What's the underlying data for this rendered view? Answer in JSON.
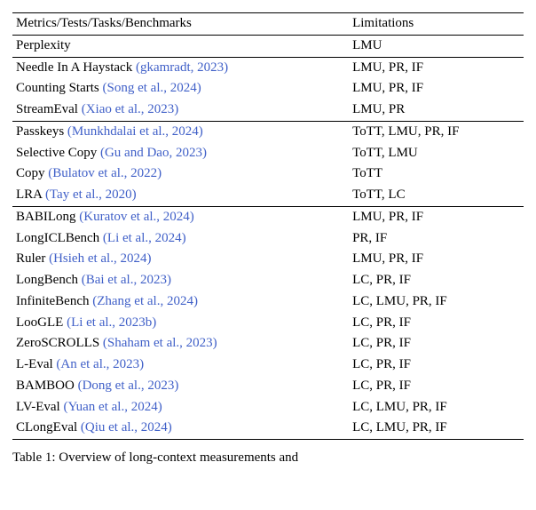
{
  "header": {
    "col1": "Metrics/Tests/Tasks/Benchmarks",
    "col2": "Limitations"
  },
  "groups": [
    {
      "rows": [
        {
          "name": "Perplexity",
          "ref": null,
          "lim": "LMU"
        }
      ]
    },
    {
      "rows": [
        {
          "name": "Needle In A Haystack ",
          "ref": "(gkamradt, 2023)",
          "lim": "LMU, PR, IF"
        },
        {
          "name": "Counting Starts ",
          "ref": "(Song et al., 2024)",
          "lim": "LMU, PR, IF"
        },
        {
          "name": "StreamEval ",
          "ref": "(Xiao et al., 2023)",
          "lim": "LMU, PR"
        }
      ]
    },
    {
      "rows": [
        {
          "name": "Passkeys ",
          "ref": "(Munkhdalai et al., 2024)",
          "lim": "ToTT, LMU, PR, IF"
        },
        {
          "name": "Selective Copy ",
          "ref": "(Gu and Dao, 2023)",
          "lim": "ToTT, LMU"
        },
        {
          "name": "Copy ",
          "ref": "(Bulatov et al., 2022)",
          "lim": "ToTT"
        },
        {
          "name": "LRA ",
          "ref": "(Tay et al., 2020)",
          "lim": "ToTT, LC"
        }
      ]
    },
    {
      "rows": [
        {
          "name": "BABILong ",
          "ref": "(Kuratov et al., 2024)",
          "lim": "LMU, PR, IF"
        },
        {
          "name": "LongICLBench ",
          "ref": "(Li et al., 2024)",
          "lim": "PR, IF"
        },
        {
          "name": "Ruler ",
          "ref": "(Hsieh et al., 2024)",
          "lim": "LMU, PR, IF"
        },
        {
          "name": "LongBench ",
          "ref": "(Bai et al., 2023)",
          "lim": "LC, PR, IF"
        },
        {
          "name": "InfiniteBench ",
          "ref": "(Zhang et al., 2024)",
          "lim": "LC, LMU, PR, IF"
        },
        {
          "name": "LooGLE ",
          "ref": "(Li et al., 2023b)",
          "lim": "LC, PR, IF"
        },
        {
          "name": "ZeroSCROLLS ",
          "ref": "(Shaham et al., 2023)",
          "lim": "LC, PR, IF"
        },
        {
          "name": "L-Eval ",
          "ref": "(An et al., 2023)",
          "lim": "LC, PR, IF"
        },
        {
          "name": "BAMBOO ",
          "ref": "(Dong et al., 2023)",
          "lim": "LC, PR, IF"
        },
        {
          "name": "LV-Eval ",
          "ref": "(Yuan et al., 2024)",
          "lim": "LC, LMU, PR, IF"
        },
        {
          "name": "CLongEval ",
          "ref": "(Qiu et al., 2024)",
          "lim": "LC, LMU, PR, IF"
        }
      ]
    }
  ],
  "caption": {
    "label": "Table 1:",
    "text": " Overview of long-context measurements and"
  }
}
